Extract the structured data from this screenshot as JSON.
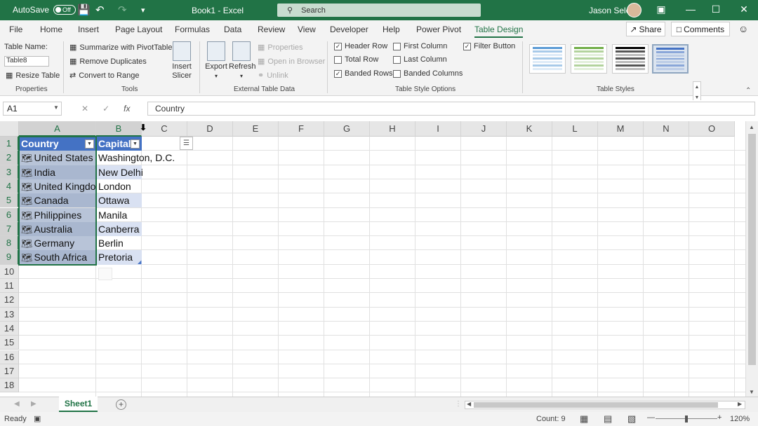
{
  "titlebar": {
    "autosave_label": "AutoSave",
    "autosave_state": "Off",
    "doc_title": "Book1 - Excel",
    "search_placeholder": "Search",
    "user_name": "Jason Sele",
    "icons": [
      "save-icon",
      "undo-icon",
      "redo-icon",
      "customize-icon",
      "ribbon-display-icon",
      "minimize-icon",
      "maximize-icon",
      "close-icon"
    ]
  },
  "menu": {
    "tabs": [
      "File",
      "Home",
      "Insert",
      "Page Layout",
      "Formulas",
      "Data",
      "Review",
      "View",
      "Developer",
      "Help",
      "Power Pivot",
      "Table Design"
    ],
    "active_tab": "Table Design",
    "share_label": "Share",
    "comments_label": "Comments"
  },
  "ribbon": {
    "properties": {
      "table_name_label": "Table Name:",
      "table_name_value": "Table8",
      "resize_label": "Resize Table",
      "group_label": "Properties"
    },
    "tools": {
      "summarize": "Summarize with PivotTable",
      "remove_duplicates": "Remove Duplicates",
      "convert_range": "Convert to Range",
      "insert_slicer_1": "Insert",
      "insert_slicer_2": "Slicer",
      "group_label": "Tools"
    },
    "external": {
      "export": "Export",
      "refresh": "Refresh",
      "properties": "Properties",
      "open_browser": "Open in Browser",
      "unlink": "Unlink",
      "group_label": "External Table Data"
    },
    "style_options": {
      "header_row": "Header Row",
      "total_row": "Total Row",
      "banded_rows": "Banded Rows",
      "first_column": "First Column",
      "last_column": "Last Column",
      "banded_columns": "Banded Columns",
      "filter_button": "Filter Button",
      "group_label": "Table Style Options"
    },
    "styles": {
      "group_label": "Table Styles",
      "colors": [
        "#5b9bd5",
        "#70ad47",
        "#000000",
        "#4472c4"
      ]
    }
  },
  "formula_bar": {
    "name_box": "A1",
    "formula": "Country"
  },
  "grid": {
    "columns": [
      "A",
      "B",
      "C",
      "D",
      "E",
      "F",
      "G",
      "H",
      "I",
      "J",
      "K",
      "L",
      "M",
      "N",
      "O"
    ],
    "rows": [
      "1",
      "2",
      "3",
      "4",
      "5",
      "6",
      "7",
      "8",
      "9",
      "10",
      "11",
      "12",
      "13",
      "14",
      "15",
      "16",
      "17",
      "18"
    ],
    "header": {
      "country": "Country",
      "capital": "Capital"
    },
    "data": [
      {
        "country": "United States",
        "capital": "Washington, D.C."
      },
      {
        "country": "India",
        "capital": "New Delhi"
      },
      {
        "country": "United Kingdom",
        "capital": "London"
      },
      {
        "country": "Canada",
        "capital": "Ottawa"
      },
      {
        "country": "Philippines",
        "capital": "Manila"
      },
      {
        "country": "Australia",
        "capital": "Canberra"
      },
      {
        "country": "Germany",
        "capital": "Berlin"
      },
      {
        "country": "South Africa",
        "capital": "Pretoria"
      }
    ],
    "header_color": "#4472c4",
    "band_color": "#d9e1f2"
  },
  "sheets": {
    "active": "Sheet1"
  },
  "status": {
    "ready": "Ready",
    "count": "Count: 9",
    "zoom": "120%"
  }
}
